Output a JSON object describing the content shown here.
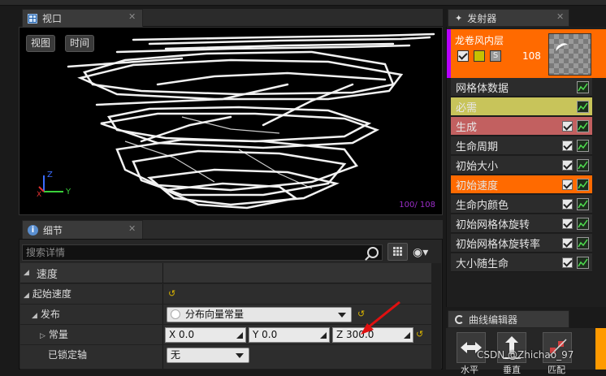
{
  "viewport": {
    "tab_title": "视口",
    "buttons": [
      "视图",
      "时间"
    ],
    "particle_counter": "100/ 108",
    "axis_labels": {
      "z": "Z",
      "y": "Y",
      "x": "X"
    }
  },
  "details": {
    "tab_title": "细节",
    "search_placeholder": "搜索详情",
    "category": "速度",
    "rows": {
      "start_velocity": "起始速度",
      "distribution": "发布",
      "distribution_value": "分布向量常量",
      "constant": "常量",
      "x": "X  0.0",
      "y": "Y  0.0",
      "z": "Z  300.0",
      "locked_axis": "已锁定轴",
      "locked_axis_value": "无"
    }
  },
  "emitter": {
    "tab_title": "发射器",
    "name": "龙卷风内层",
    "count": "108",
    "header_color": "#ff6a00",
    "modules": [
      {
        "label": "网格体数据",
        "bg": "#2c2c2c",
        "check": false
      },
      {
        "label": "必需",
        "bg": "#c8c45a",
        "check": false
      },
      {
        "label": "生成",
        "bg": "#c26060",
        "check": true
      },
      {
        "label": "生命周期",
        "bg": "#2c2c2c",
        "check": true
      },
      {
        "label": "初始大小",
        "bg": "#2c2c2c",
        "check": true
      },
      {
        "label": "初始速度",
        "bg": "#ff6a00",
        "check": true
      },
      {
        "label": "生命内颜色",
        "bg": "#2c2c2c",
        "check": true
      },
      {
        "label": "初始网格体旋转",
        "bg": "#2c2c2c",
        "check": true
      },
      {
        "label": "初始网格体旋转率",
        "bg": "#2c2c2c",
        "check": true
      },
      {
        "label": "大小随生命",
        "bg": "#2c2c2c",
        "check": true
      }
    ]
  },
  "curve_editor": {
    "tab_title": "曲线编辑器",
    "tools": [
      "水平",
      "垂直",
      "匹配"
    ]
  },
  "watermark": "CSDN @Zhichao_97"
}
